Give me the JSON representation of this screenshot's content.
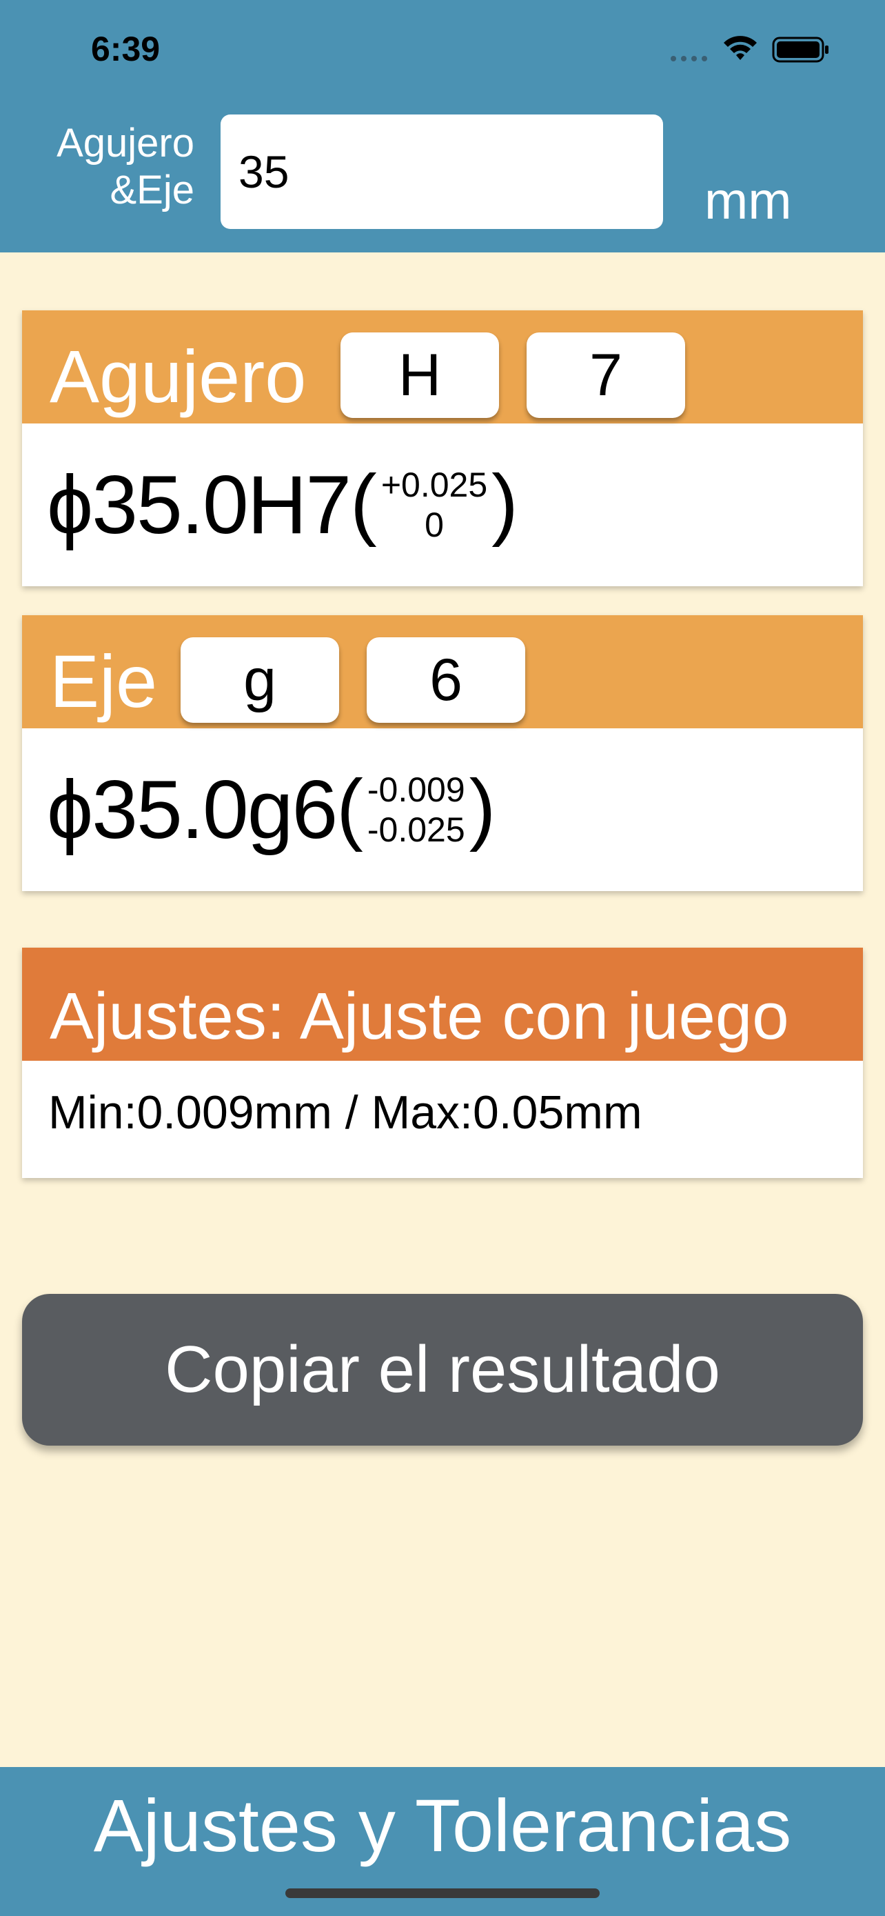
{
  "status_bar": {
    "time": "6:39",
    "icons": [
      "cellular-signal-icon",
      "wifi-icon",
      "battery-icon"
    ]
  },
  "input": {
    "label_line1": "Agujero",
    "label_line2": "&Eje",
    "value": "35",
    "unit": "mm"
  },
  "hole": {
    "title": "Agujero",
    "letter": "H",
    "grade": "7",
    "result_main": "ϕ35.0H7",
    "open_paren": "(",
    "upper_tol": "+0.025",
    "lower_tol": "0",
    "close_paren": ")"
  },
  "shaft": {
    "title": "Eje",
    "letter": "g",
    "grade": "6",
    "result_main": "ϕ35.0g6",
    "open_paren": "(",
    "upper_tol": "-0.009",
    "lower_tol": "-0.025",
    "close_paren": ")"
  },
  "fit": {
    "title": "Ajustes: Ajuste con juego",
    "summary": "Min:0.009mm / Max:0.05mm"
  },
  "copy_button": {
    "label": "Copiar el resultado"
  },
  "footer": {
    "title": "Ajustes y Tolerancias"
  },
  "colors": {
    "header_blue": "#4b92b3",
    "background_cream": "#fdf3d7",
    "card_header_orange": "#eba54f",
    "fit_header_orange": "#e07b3a",
    "copy_button_gray": "#595c60"
  }
}
